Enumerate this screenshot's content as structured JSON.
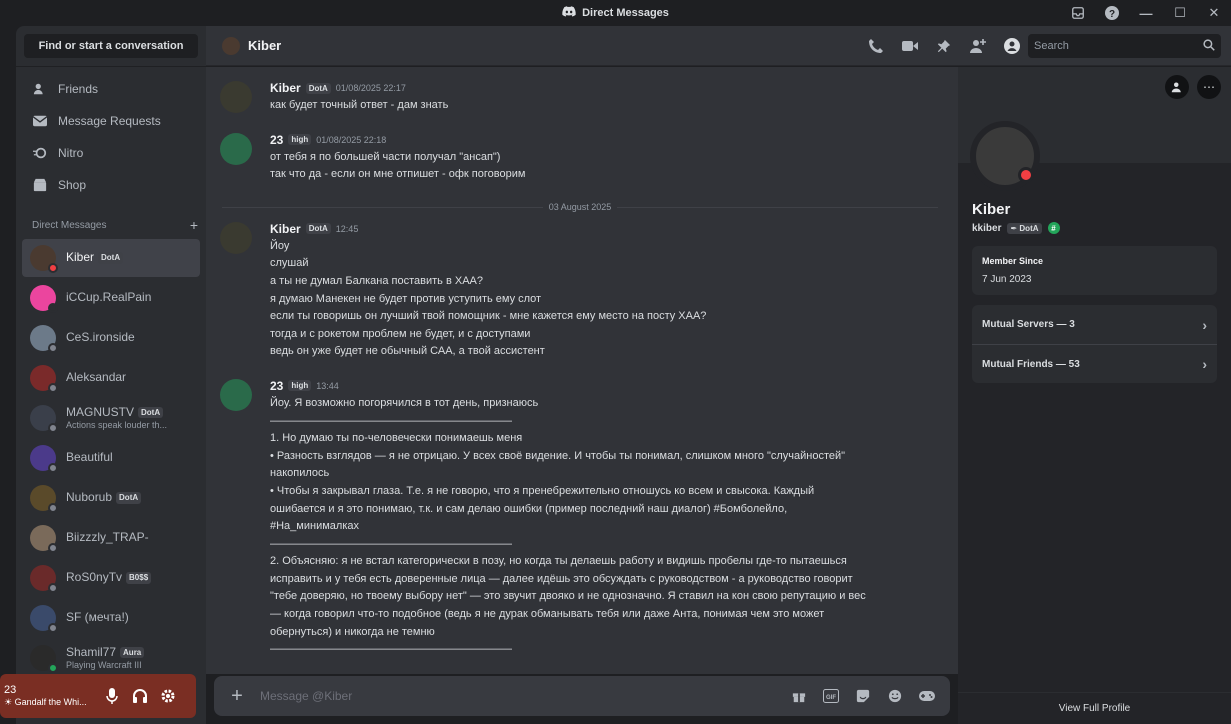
{
  "window": {
    "title": "Direct Messages"
  },
  "sidebar": {
    "search_label": "Find or start a conversation",
    "nav": [
      {
        "label": "Friends",
        "icon": "friends-icon"
      },
      {
        "label": "Message Requests",
        "icon": "envelope-icon"
      },
      {
        "label": "Nitro",
        "icon": "nitro-icon"
      },
      {
        "label": "Shop",
        "icon": "shop-icon"
      }
    ],
    "dm_header": "Direct Messages",
    "dms": [
      {
        "name": "Kiber",
        "tag": "DotA",
        "sub": "",
        "color": "#4a3a30",
        "status": "#f23f43"
      },
      {
        "name": "iCCup.RealPain",
        "tag": "",
        "sub": "",
        "color": "#eb459e",
        "status": "#2b2d31"
      },
      {
        "name": "CeS.ironside",
        "tag": "",
        "sub": "",
        "color": "#6c7a89",
        "status": "#80848e"
      },
      {
        "name": "Aleksandar",
        "tag": "",
        "sub": "",
        "color": "#7a2a2a",
        "status": "#80848e"
      },
      {
        "name": "MAGNUSTV",
        "tag": "DotA",
        "sub": "Actions speak louder th...",
        "color": "#3a3f4a",
        "status": "#80848e"
      },
      {
        "name": "Beautiful",
        "tag": "",
        "sub": "",
        "color": "#4b3a8a",
        "status": "#80848e"
      },
      {
        "name": "Nuborub",
        "tag": "DotA",
        "sub": "",
        "color": "#5a4a2a",
        "status": "#80848e"
      },
      {
        "name": "Biizzzly_TRAP-",
        "tag": "",
        "sub": "",
        "color": "#7a6a5a",
        "status": "#80848e"
      },
      {
        "name": "RoS0nyTv",
        "tag": "B0$$",
        "sub": "",
        "color": "#6a2a2a",
        "status": "#80848e"
      },
      {
        "name": "SF (мечта!)",
        "tag": "",
        "sub": "",
        "color": "#3a4a6a",
        "status": "#80848e"
      },
      {
        "name": "Shamil77",
        "tag": "Aura",
        "sub": "Playing Warcraft III",
        "color": "#2a2a2a",
        "status": "#23a55a"
      }
    ]
  },
  "user_panel": {
    "name": "23",
    "status": "Gandalf the Whi..."
  },
  "chat": {
    "recipient": "Kiber",
    "search_placeholder": "Search",
    "composer_placeholder": "Message @Kiber",
    "date_separator": "03 August 2025",
    "messages_before": [
      {
        "author": "Kiber",
        "tag": "DotA",
        "time": "01/08/2025 22:17",
        "avatar_color": "#3a3a30",
        "lines": [
          "как будет точный ответ - дам знать"
        ]
      },
      {
        "author": "23",
        "tag": "high",
        "time": "01/08/2025 22:18",
        "avatar_color": "#2a6a4a",
        "lines": [
          "от тебя я по большей части получал \"ансап\")",
          "так что да - если он мне отпишет - офк поговорим"
        ]
      }
    ],
    "messages_after": [
      {
        "author": "Kiber",
        "tag": "DotA",
        "time": "12:45",
        "avatar_color": "#3a3a30",
        "lines": [
          "Йоу",
          "слушай",
          "а ты не думал Балкана поставить в ХАА?",
          "я думаю Манекен не будет против уступить ему слот",
          "если ты говоришь он лучший твой помощник - мне кажется ему место на посту ХАА?",
          "тогда и с рокетом проблем не будет, и с доступами",
          "ведь он уже будет не обычный САА, а твой ассистент"
        ]
      },
      {
        "author": "23",
        "tag": "high",
        "time": "13:44",
        "avatar_color": "#2a6a4a",
        "lines": [
          "Йоу. Я возможно погорячился в тот день, признаюсь",
          "——————————————————————",
          "1. Но думаю ты по-человечески понимаешь меня",
          "• Разность взглядов — я не отрицаю. У всех своё видение. И чтобы ты понимал, слишком много \"случайностей\"",
          "накопилось",
          "• Чтобы я закрывал глаза. Т.е. я не говорю, что я пренебрежительно отношусь ко всем и свысока. Каждый",
          "ошибается и я это понимаю, т.к. и сам делаю ошибки (пример последний наш диалог) #Бомболейло,",
          "#На_минималках",
          "——————————————————————",
          "2. Объясняю: я не встал категорически в позу, но когда ты делаешь работу и видишь пробелы где-то пытаешься",
          "исправить и у тебя есть доверенные лица — далее идёшь это обсуждать с руководством - а руководство говорит",
          "\"тебе доверяю, но твоему выбору нет\" — это звучит двояко и не однозначно. Я ставил на кон свою репутацию и вес",
          "— когда говорил что-то подобное (ведь я не дурак обманывать тебя или даже Анта, понимая чем это может",
          "обернуться) и никогда не темню",
          "——————————————————————"
        ]
      }
    ]
  },
  "profile": {
    "name": "Kiber",
    "username": "kkiber",
    "tag": "DotA",
    "member_since_label": "Member Since",
    "member_since": "7 Jun 2023",
    "mutual_servers": "Mutual Servers — 3",
    "mutual_friends": "Mutual Friends — 53",
    "footer": "View Full Profile"
  },
  "colors": {
    "accent": "#5865f2",
    "dnd": "#f23f43",
    "online": "#23a55a"
  }
}
